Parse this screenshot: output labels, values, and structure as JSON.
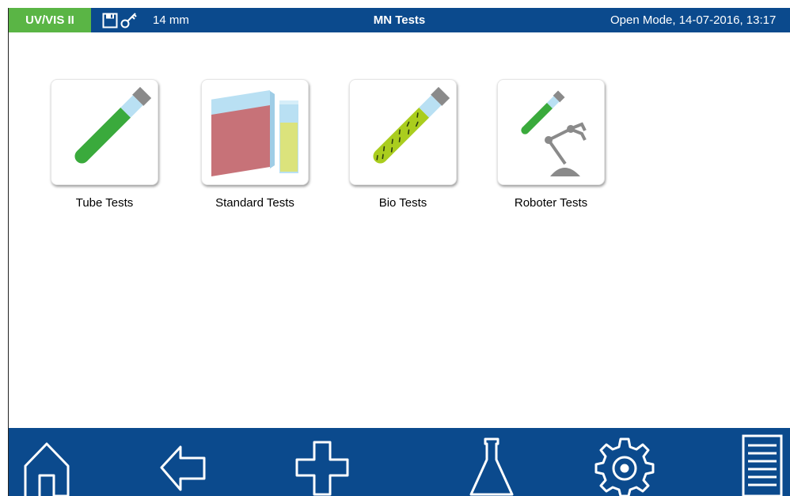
{
  "header": {
    "brand": "UV/VIS II",
    "path_length": "14 mm",
    "title": "MN Tests",
    "mode_info": "Open Mode, 14-07-2016, 13:17"
  },
  "tests": [
    {
      "label": "Tube Tests",
      "icon": "tube-test-icon"
    },
    {
      "label": "Standard Tests",
      "icon": "cuvette-test-icon"
    },
    {
      "label": "Bio Tests",
      "icon": "bio-tube-icon"
    },
    {
      "label": "Roboter Tests",
      "icon": "robot-arm-icon"
    }
  ],
  "nav": [
    "home-icon",
    "back-arrow-icon",
    "plus-icon",
    "flask-icon",
    "gear-icon",
    "menu-list-icon"
  ],
  "colors": {
    "bar": "#0b4a8d",
    "brand": "#5ab545",
    "tube_liquid": "#3aaa3c",
    "bio_liquid": "#aacd1e",
    "cuvette_red": "#c77278",
    "cuvette_yellow": "#dbe37c",
    "glass": "#b9e0f3",
    "cap": "#8a8a8a"
  }
}
